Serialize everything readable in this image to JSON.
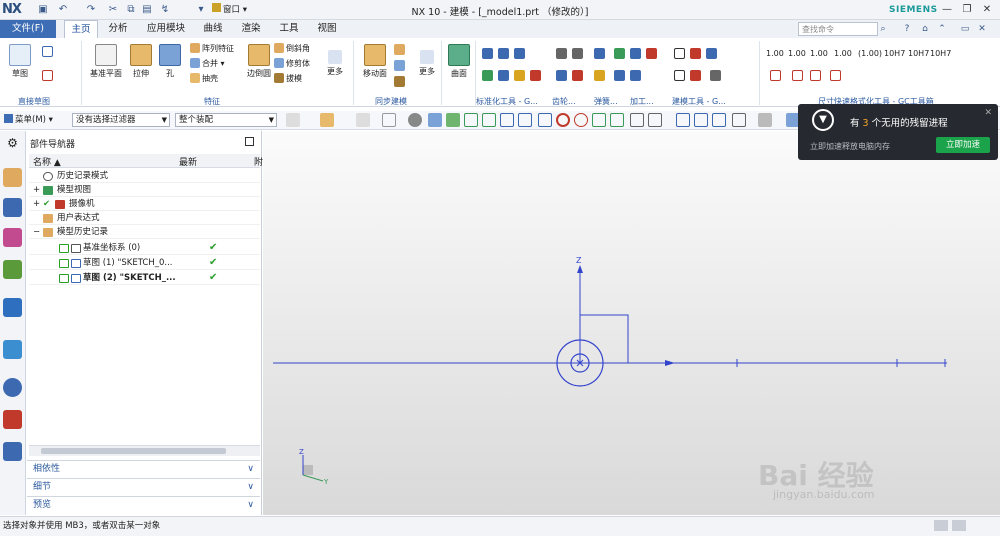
{
  "title_bar": {
    "logo": "NX",
    "window_title": "NX 10 - 建模 - [_model1.prt （修改的）]",
    "window_menu": "窗口",
    "brand": "SIEMENS"
  },
  "menu": {
    "file_tab": "文件(F)",
    "tabs": [
      "主页",
      "分析",
      "应用模块",
      "曲线",
      "渲染",
      "工具",
      "视图"
    ],
    "active_tab": "主页",
    "search_placeholder": "查找命令"
  },
  "ribbon": {
    "sketch_group": {
      "big": "草图",
      "label": "直接草图"
    },
    "feature_group": {
      "label": "特征",
      "big": [
        "基准平面",
        "拉伸",
        "孔",
        "边倒圆",
        "更多"
      ],
      "small": [
        "阵列特征",
        "合并",
        "抽壳",
        "倒斜角",
        "修剪体",
        "拔模"
      ]
    },
    "sync_group": {
      "label": "同步建模",
      "big": [
        "移动面",
        "更多"
      ]
    },
    "surface_big": "曲面",
    "group_labels": [
      "标准化工具 - G...",
      "齿轮...",
      "弹簧...",
      "加工...",
      "建模工具 - G...",
      "尺寸快速格式化工具 - GC工具箱"
    ],
    "dim_labels": [
      "1.00",
      "1.00",
      "1.00",
      "1.00",
      "(1.00)",
      "10H7",
      "10H7",
      "10H7"
    ]
  },
  "toolbar": {
    "menu_button": "菜单(M)",
    "filter": "没有选择过滤器",
    "assembly": "整个装配"
  },
  "navigator": {
    "title": "部件导航器",
    "col_name": "名称",
    "col_latest": "最新",
    "col_more": "附",
    "rows": [
      {
        "label": "历史记录模式",
        "latest": ""
      },
      {
        "label": "模型视图",
        "latest": ""
      },
      {
        "label": "摄像机",
        "latest": ""
      },
      {
        "label": "用户表达式",
        "latest": ""
      },
      {
        "label": "模型历史记录",
        "latest": ""
      },
      {
        "label": "基准坐标系 (0)",
        "latest": "✔"
      },
      {
        "label": "草图 (1) \"SKETCH_0...",
        "latest": "✔"
      },
      {
        "label": "草图 (2) \"SKETCH_...",
        "latest": "✔"
      }
    ],
    "panels": [
      "相依性",
      "细节",
      "预览"
    ]
  },
  "viewport": {
    "axis_z": "Z",
    "triad_z": "Z",
    "triad_y": "Y"
  },
  "status": {
    "text": "选择对象并使用 MB3，或者双击某一对象"
  },
  "popup": {
    "prefix": "有 ",
    "count": "3",
    "suffix": " 个无用的残留进程",
    "subtitle": "立即加速释放电脑内存",
    "button": "立即加速"
  },
  "watermark": {
    "brand": "Bai 经验",
    "url": "jingyan.baidu.com"
  }
}
